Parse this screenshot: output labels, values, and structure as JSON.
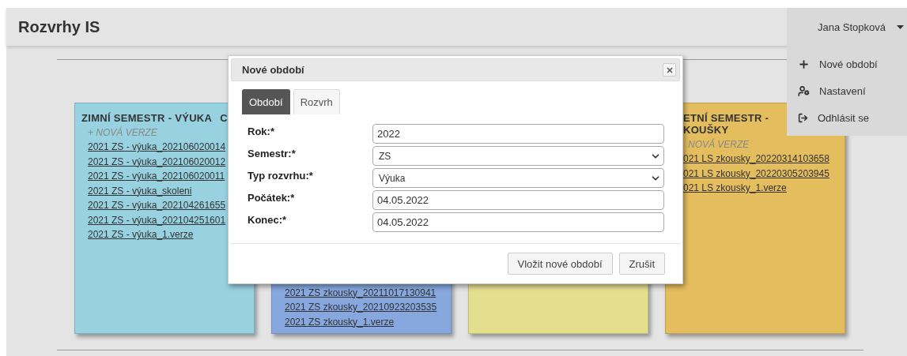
{
  "header": {
    "title": "Rozvrhy IS",
    "user": "Jana Stopková"
  },
  "user_menu": [
    {
      "label": "Nové období",
      "kind": "add"
    },
    {
      "label": "Nastavení",
      "kind": "settings"
    },
    {
      "label": "Odhlásit se",
      "kind": "logout"
    }
  ],
  "cards": [
    {
      "color": "#98d1e0",
      "title_lines": [
        "ZIMNÍ SEMESTR - VÝUKA"
      ],
      "title_suffix": "C",
      "new_version": "+ NOVÁ VERZE",
      "items": [
        "2021 ZS - výuka_202106020014",
        "2021 ZS - výuka_202106020012",
        "2021 ZS - výuka_202106020011",
        "2021 ZS - výuka_skoleni",
        "2021 ZS - výuka_202104261655",
        "2021 ZS - výuka_202104251601",
        "2021 ZS - výuka_1.verze"
      ]
    },
    {
      "color": "#86a8de",
      "items": [
        "2021 ZS zkousky_20211017130941",
        "2021 ZS zkousky_20210923203535",
        "2021 ZS zkousky_1.verze"
      ]
    },
    {
      "color": "#e4df8e"
    },
    {
      "color": "#e4bd5e",
      "title_lines": [
        "ETNÍ SEMESTR -",
        "KOUŠKY"
      ],
      "new_version": "NOVÁ VERZE",
      "items": [
        "021 LS zkousky_20220314103658",
        "021 LS zkousky_20220305203945",
        "021 LS zkousky_1.verze"
      ]
    }
  ],
  "dialog": {
    "title": "Nové období",
    "tabs": [
      {
        "label": "Období",
        "selected": true
      },
      {
        "label": "Rozvrh",
        "selected": false
      }
    ],
    "fields": [
      {
        "label": "Rok:*",
        "kind": "text",
        "value": "2022"
      },
      {
        "label": "Semestr:*",
        "kind": "select",
        "value": "ZS"
      },
      {
        "label": "Typ rozvrhu:*",
        "kind": "select",
        "value": "Výuka"
      },
      {
        "label": "Počátek:*",
        "kind": "text",
        "value": "04.05.2022"
      },
      {
        "label": "Konec:*",
        "kind": "text",
        "value": "04.05.2022"
      }
    ],
    "buttons": [
      "Vložit nové období",
      "Zrušit"
    ]
  }
}
